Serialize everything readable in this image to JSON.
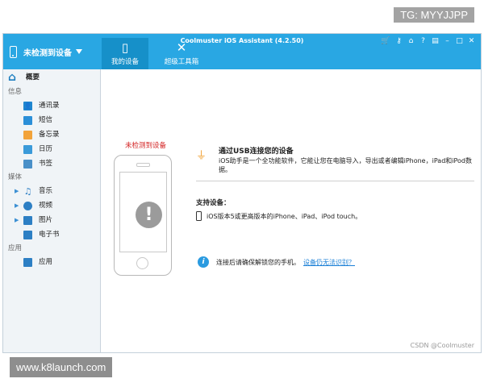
{
  "watermarks": {
    "tg": "TG: MYYJJPP",
    "site": "www.k8launch.com",
    "credit": "CSDN @Coolmuster"
  },
  "app": {
    "title": "Coolmuster iOS Assistant (4.2.50)"
  },
  "device_select": {
    "label": "未检测到设备"
  },
  "tabs": [
    {
      "label": "我的设备",
      "icon": "phone-icon"
    },
    {
      "label": "超级工具箱",
      "icon": "toolbox-icon"
    }
  ],
  "window_controls": [
    "cart-icon",
    "key-icon",
    "home-icon",
    "help-icon",
    "feedback-icon",
    "minimize-icon",
    "maximize-icon",
    "close-icon"
  ],
  "sidebar": {
    "home": "概要",
    "cat_info": "信息",
    "cat_media": "媒体",
    "cat_apps": "应用",
    "info_items": [
      {
        "label": "通讯录",
        "color": "#1f86cf"
      },
      {
        "label": "短信",
        "color": "#2b8fd8"
      },
      {
        "label": "备忘录",
        "color": "#f2a33a"
      },
      {
        "label": "日历",
        "color": "#3a9ad9"
      },
      {
        "label": "书签",
        "color": "#4a90c8"
      }
    ],
    "media_items": [
      {
        "label": "音乐",
        "color": "#2d7fc4"
      },
      {
        "label": "视频",
        "color": "#2d7fc4"
      },
      {
        "label": "图片",
        "color": "#2d7fc4"
      },
      {
        "label": "电子书",
        "color": "#2d7fc4"
      }
    ],
    "app_items": [
      {
        "label": "应用",
        "color": "#2d7fc4"
      }
    ]
  },
  "main": {
    "no_device": "未检测到设备",
    "usb_title": "通过USB连接您的设备",
    "usb_desc": "iOS助手是一个全功能软件，它能让您在电脑导入，导出或者编辑iPhone，iPad和iPod数据。",
    "support_title": "支持设备：",
    "support_desc": "iOS版本5或更高版本的iPhone、iPad、iPod touch。",
    "help_text": "连接后请确保解锁您的手机。",
    "help_link": "设备仍无法识别？"
  }
}
